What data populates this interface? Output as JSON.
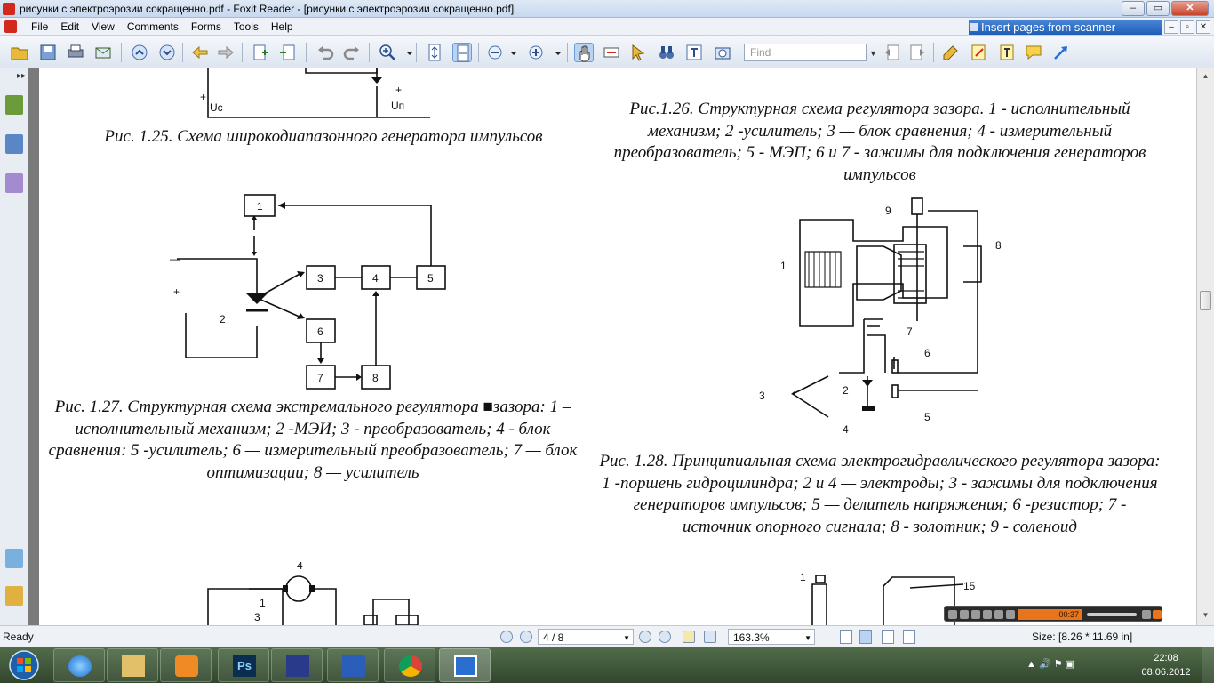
{
  "window": {
    "title": "рисунки с электроэрозии сокращенно.pdf - Foxit Reader - [рисунки с электроэрозии сокращенно.pdf]",
    "minimize_glyph": "–",
    "maximize_glyph": "▭",
    "close_glyph": "✕"
  },
  "menu": {
    "items": [
      "File",
      "Edit",
      "View",
      "Comments",
      "Forms",
      "Tools",
      "Help"
    ],
    "promo": "Insert pages from scanner",
    "doc_buttons": [
      "–",
      "▫",
      "✕"
    ]
  },
  "toolbar": {
    "find_placeholder": "Find",
    "find_dropdown_glyph": "▼"
  },
  "document": {
    "captions": {
      "fig_1_25": "Рис. 1.25. Схема широкодиапазонного генератора импульсов",
      "fig_1_26": "Рис.1.26. Структурная схема регулятора зазора. 1 - исполнительный механизм; 2 -усилитель; 3 — блок сравнения; 4 - измерительный преобразователь; 5 - МЭП; 6 и 7 - зажимы для подключения генераторов импульсов",
      "fig_1_27": "Рис. 1.27. Структурная схема экстремального регулятора ■зазора: 1 – исполнительный механизм; 2 -МЭИ; 3 - преобразователь; 4 - блок сравнения: 5 -усилитель; 6 — измерительный преобразователь; 7 — блок оптимизации; 8 — усилитель",
      "fig_1_28": "Рис. 1.28. Принципиальная схема электрогидравлического регулятора зазора: 1 -поршень гидроцилиндра; 2 и 4 — электроды; 3 - зажимы для подключения генераторов импульсов; 5 — делитель напряжения; 6 -резистор; 7 - источник опорного сигнала; 8 - золотник; 9 - соленоид"
    },
    "fig_1_25_labels": {
      "uc": "Uс",
      "un": "Uп",
      "plus": "+"
    },
    "fig_1_27_labels": {
      "b1": "1",
      "b3": "3",
      "b4": "4",
      "b5": "5",
      "b6": "6",
      "b7": "7",
      "b8": "8",
      "n2": "2",
      "minus": "—",
      "plus": "+"
    },
    "fig_1_28_labels": {
      "n1": "1",
      "n2": "2",
      "n3": "3",
      "n4": "4",
      "n5": "5",
      "n6": "6",
      "n7": "7",
      "n8": "8",
      "n9": "9"
    },
    "bottom_left_labels": {
      "n1": "1",
      "n3": "3",
      "n4": "4"
    },
    "bottom_right_labels": {
      "n1": "1",
      "n15": "15"
    }
  },
  "media": {
    "time": "00:37"
  },
  "status": {
    "ready": "Ready",
    "page": "4 / 8",
    "zoom": "163.3%",
    "size": "Size: [8.26 * 11.69 in]"
  },
  "taskbar": {
    "time": "22:08",
    "date": "08.06.2012",
    "tray_icons": "▲ 🔊 ⚑ ▣"
  }
}
